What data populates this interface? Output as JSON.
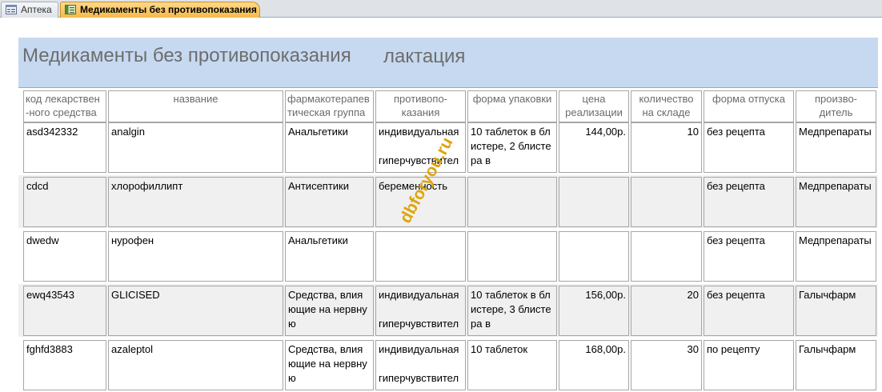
{
  "tabs": [
    {
      "label": "Аптека"
    },
    {
      "label": "Медикаменты без противопоказания"
    }
  ],
  "report": {
    "title": "Медикаменты без противопоказания",
    "subtitle": "лактация"
  },
  "columns": [
    "код лекарствен -ного средства",
    "название",
    "фармакотерапев тическая группа",
    "противопо- казания",
    "форма упаковки",
    "цена реализации",
    "количество на складе",
    "форма отпуска",
    "произво- дитель"
  ],
  "rows": [
    {
      "code": "asd342332",
      "name": "analgin",
      "group": "Анальгетики",
      "contra1": "индивидуальная",
      "contra2": "гиперчувствител",
      "pack": "10 таблеток в блистере, 2 блистера в",
      "price": "144,00р.",
      "qty": "10",
      "dispense": "без рецепта",
      "maker": "Медпрепараты"
    },
    {
      "code": "cdcd",
      "name": "хлорофиллипт",
      "group": "Антисептики",
      "contra1": "беременность",
      "contra2": "",
      "pack": "",
      "price": "",
      "qty": "",
      "dispense": "без рецепта",
      "maker": "Медпрепараты"
    },
    {
      "code": "dwedw",
      "name": "нурофен",
      "group": "Анальгетики",
      "contra1": "",
      "contra2": "",
      "pack": "",
      "price": "",
      "qty": "",
      "dispense": "без рецепта",
      "maker": "Медпрепараты"
    },
    {
      "code": "ewq43543",
      "name": "GLICISED",
      "group": "Средства, влияющие на нервную",
      "contra1": "индивидуальная",
      "contra2": "гиперчувствител",
      "pack": "10 таблеток в блистере, 3 блистера в",
      "price": "156,00р.",
      "qty": "20",
      "dispense": "без рецепта",
      "maker": "Галычфарм"
    },
    {
      "code": "fghfd3883",
      "name": "azaleptol",
      "group": "Средства, влияющие на нервную",
      "contra1": "индивидуальная",
      "contra2": "гиперчувствител",
      "pack": "10 таблеток",
      "price": "168,00р.",
      "qty": "30",
      "dispense": "по рецепту",
      "maker": "Галычфарм"
    }
  ],
  "watermark": "dbforyou.ru",
  "colors": {
    "header_band": "#c6d9f0",
    "alt_row": "#f0f0f0",
    "active_tab": "#f7b84a",
    "watermark": "#e0a000"
  }
}
